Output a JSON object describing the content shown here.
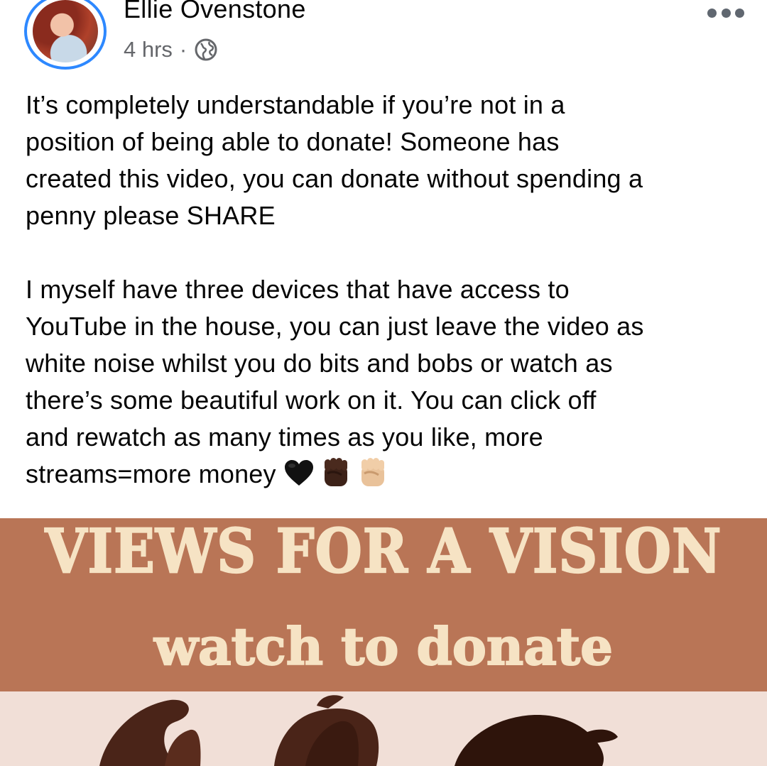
{
  "post": {
    "author": "Ellie Ovenstone",
    "time": "4 hrs",
    "separator": "·",
    "privacy_icon": "globe-icon",
    "more_icon": "more-options-icon",
    "paragraphs": [
      "It’s completely understandable if you’re not in a\nposition of being able to donate!  Someone has\ncreated this video, you can donate without spending a\npenny please SHARE",
      "I myself have three devices that have access to\nYouTube in the house, you can just leave the video as\nwhite noise whilst you do bits and bobs or watch as\nthere’s some beautiful work on it.  You can click off\nand rewatch as many times as you like, more\nstreams=more money"
    ],
    "emojis": [
      "black-heart-icon",
      "raised-fist-dark-icon",
      "raised-fist-light-icon"
    ]
  },
  "image": {
    "title": "VIEWS FOR A VISION",
    "subtitle": "watch to donate",
    "colors": {
      "banner": "#b97556",
      "banner_text": "#f6e3c4",
      "background": "#f1dfd7",
      "figures": "#4a2418"
    }
  },
  "colors": {
    "accent": "#2d88ff",
    "muted_text": "#65676b",
    "text": "#050505"
  }
}
